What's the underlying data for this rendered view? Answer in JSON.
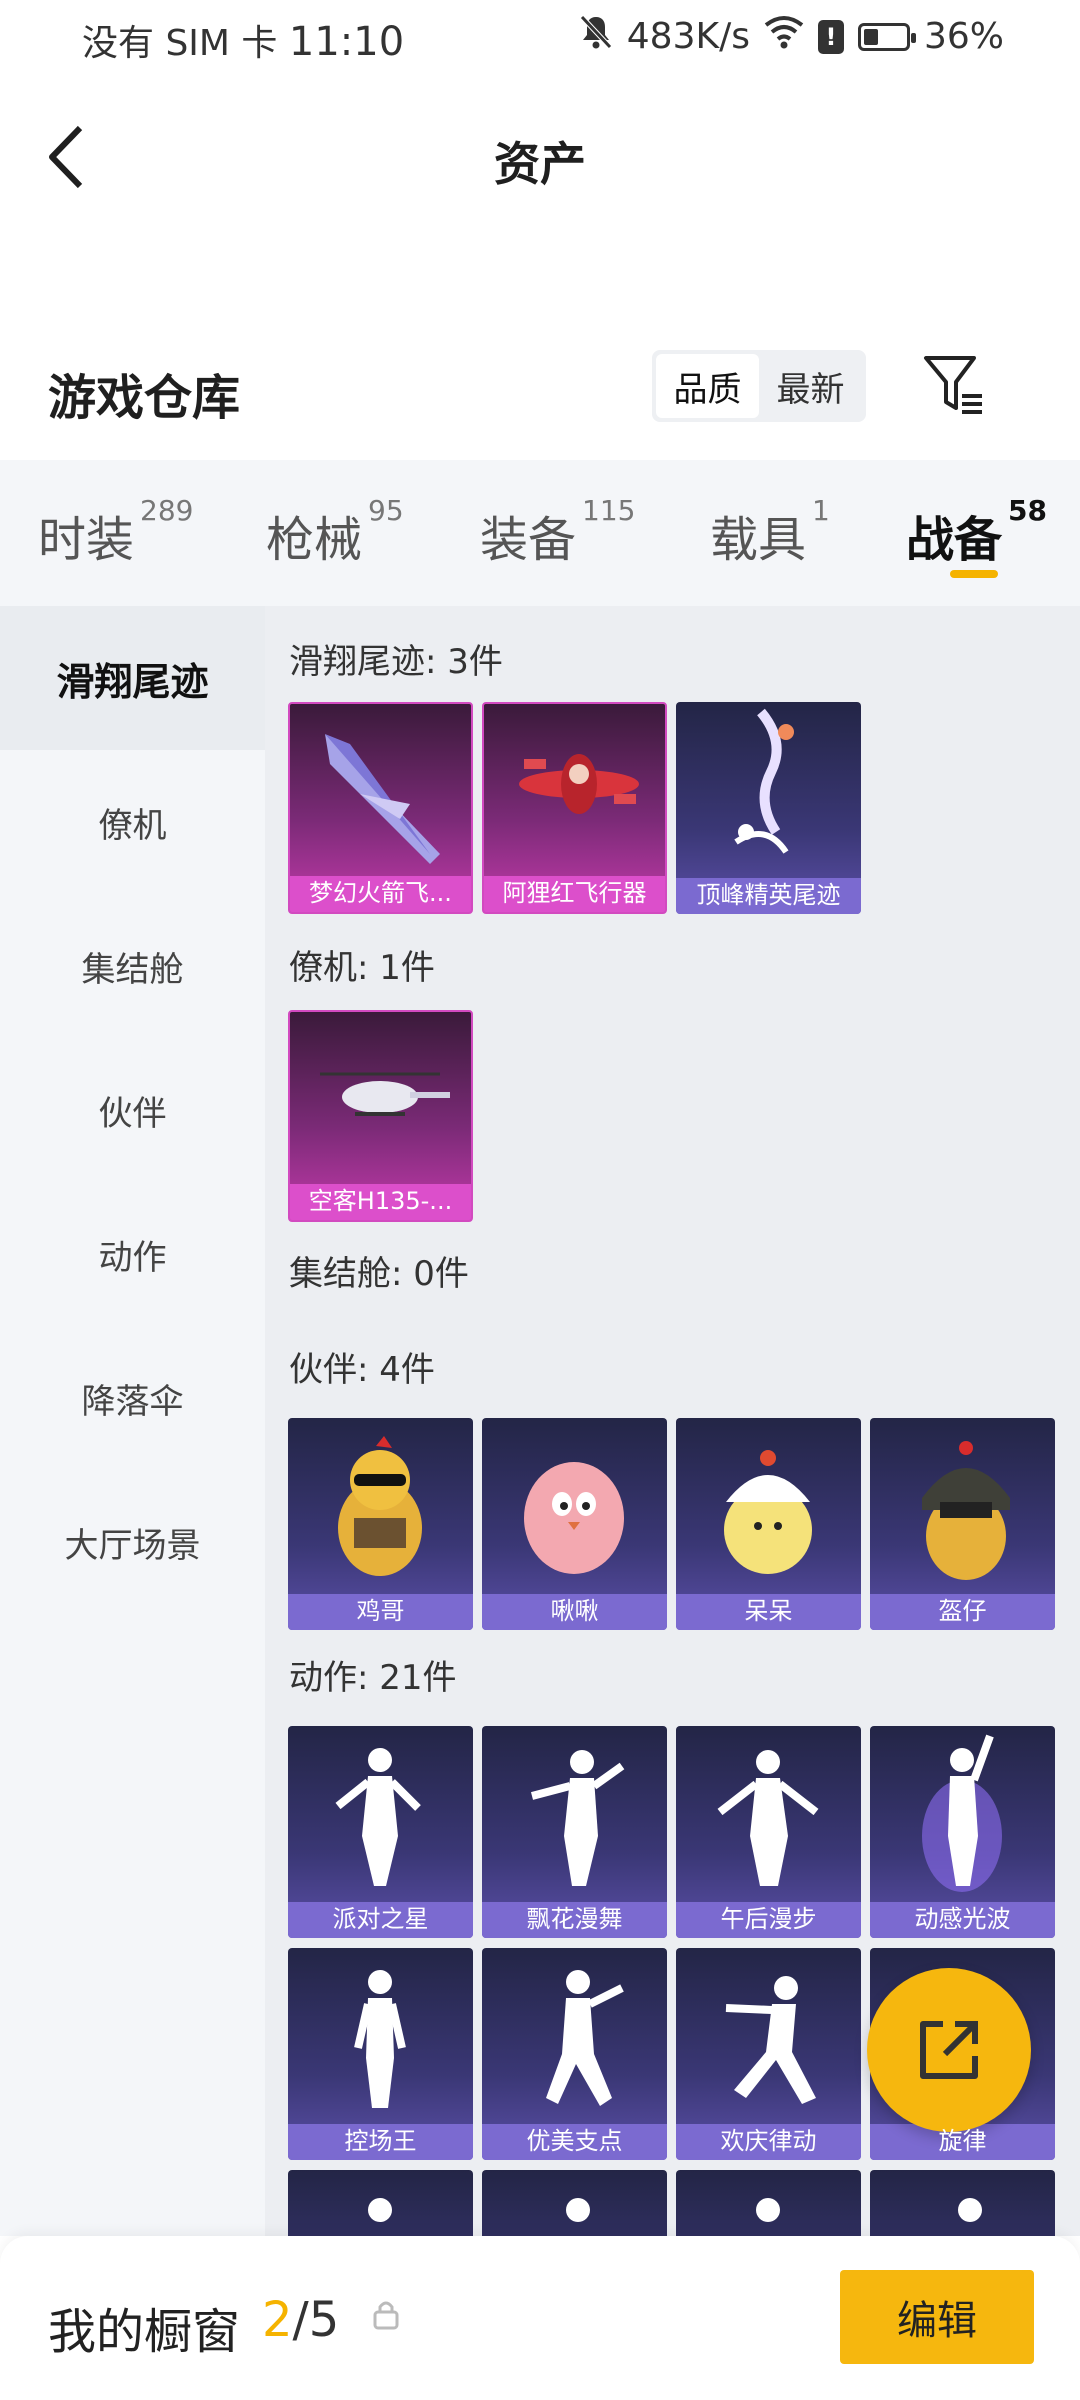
{
  "status_bar": {
    "carrier": "没有 SIM 卡",
    "time": "11:10",
    "speed": "483K/s",
    "battery_pct": "36%",
    "battery_level": 0.36
  },
  "header": {
    "title": "资产"
  },
  "warehouse": {
    "title": "游戏仓库",
    "sort_options": [
      "品质",
      "最新"
    ],
    "active_sort": "品质"
  },
  "tabs": [
    {
      "label": "时装",
      "count": "289"
    },
    {
      "label": "枪械",
      "count": "95"
    },
    {
      "label": "装备",
      "count": "115"
    },
    {
      "label": "载具",
      "count": "1"
    },
    {
      "label": "战备",
      "count": "58"
    }
  ],
  "active_tab": "战备",
  "sidebar": {
    "items": [
      "滑翔尾迹",
      "僚机",
      "集结舱",
      "伙伴",
      "动作",
      "降落伞",
      "大厅场景"
    ],
    "active": "滑翔尾迹"
  },
  "groups": [
    {
      "title": "滑翔尾迹: 3件",
      "items": [
        "梦幻火箭飞...",
        "阿狸红飞行器",
        "顶峰精英尾迹"
      ]
    },
    {
      "title": "僚机: 1件",
      "items": [
        "空客H135-..."
      ]
    },
    {
      "title": "集结舱: 0件",
      "items": []
    },
    {
      "title": "伙伴: 4件",
      "items": [
        "鸡哥",
        "啾啾",
        "呆呆",
        "盔仔"
      ]
    },
    {
      "title": "动作: 21件",
      "items": [
        "派对之星",
        "飘花漫舞",
        "午后漫步",
        "动感光波",
        "控场王",
        "优美支点",
        "欢庆律动",
        "旋律"
      ]
    }
  ],
  "bottom_bar": {
    "title": "我的橱窗",
    "current": "2",
    "total": "/5",
    "edit_label": "编辑"
  },
  "colors": {
    "accent": "#f6b70e",
    "pink_card": "#dc4fcb",
    "purple_card": "#7b6ad0"
  }
}
